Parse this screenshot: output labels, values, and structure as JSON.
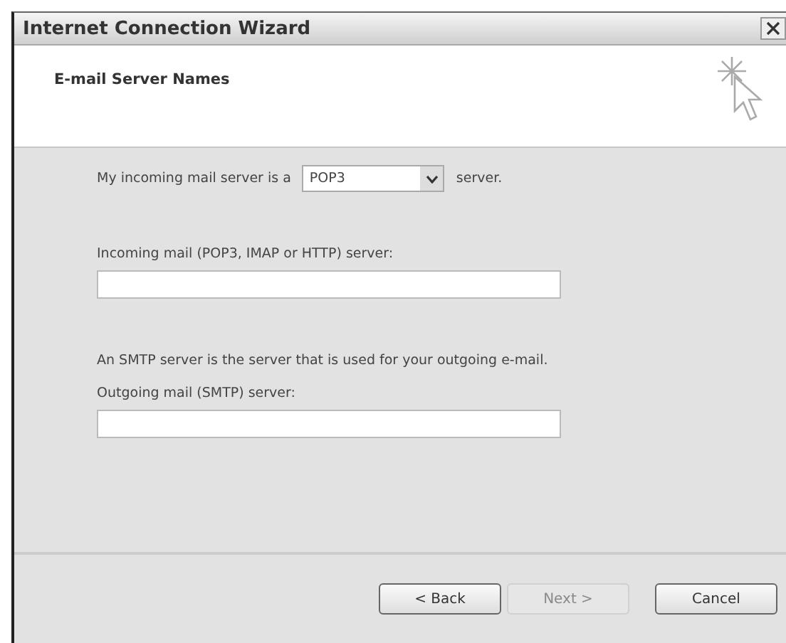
{
  "window": {
    "title": "Internet Connection Wizard"
  },
  "header": {
    "title": "E-mail Server Names"
  },
  "server_type": {
    "label_before": "My incoming mail server is a",
    "value": "POP3",
    "label_after": "server."
  },
  "incoming": {
    "label": "Incoming mail (POP3, IMAP or HTTP) server:"
  },
  "smtp_note": "An SMTP server is the server that is used for your outgoing e-mail.",
  "outgoing": {
    "label": "Outgoing mail (SMTP) server:"
  },
  "buttons": [
    {
      "label": "< Back",
      "disabled": false
    },
    {
      "label": "Next >",
      "disabled": true
    },
    {
      "label": "Cancel",
      "disabled": false
    }
  ]
}
